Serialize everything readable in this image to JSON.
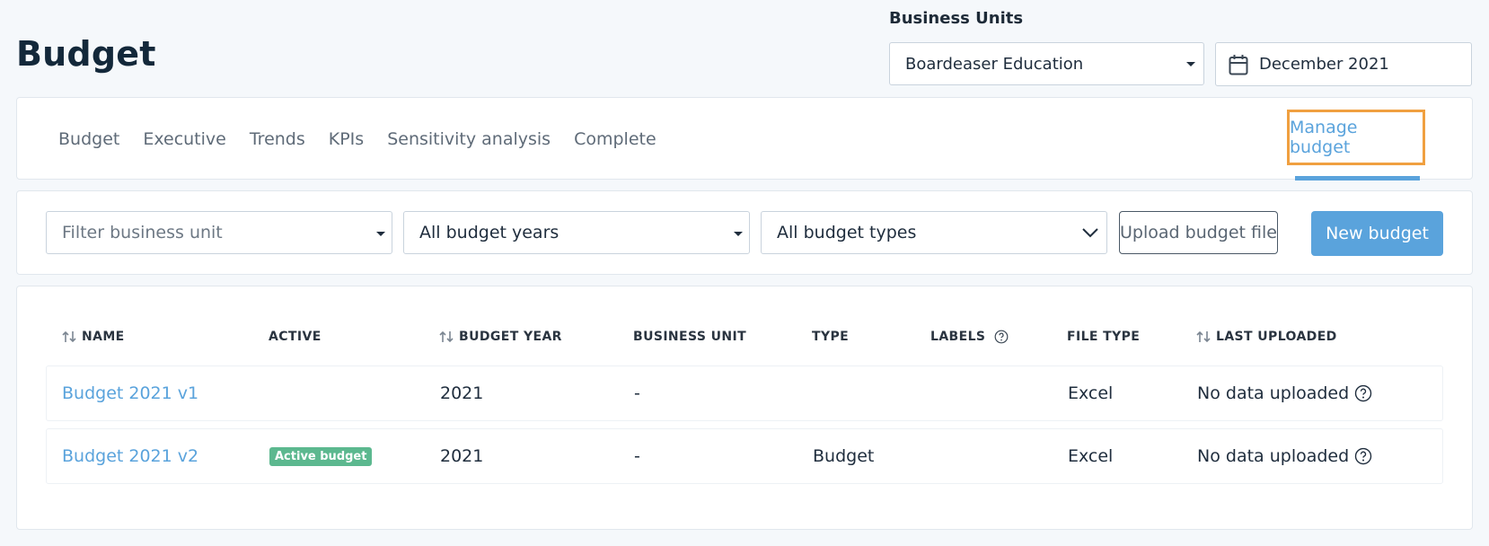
{
  "header": {
    "title": "Budget",
    "business_units_label": "Business Units",
    "business_unit_value": "Boardeaser Education",
    "date_value": "December 2021"
  },
  "nav": {
    "tabs": [
      "Budget",
      "Executive",
      "Trends",
      "KPIs",
      "Sensitivity analysis",
      "Complete"
    ],
    "manage_label": "Manage budget"
  },
  "filters": {
    "business_unit_placeholder": "Filter business unit",
    "years_value": "All budget years",
    "types_value": "All budget types",
    "upload_label": "Upload budget file",
    "new_label": "New budget"
  },
  "table": {
    "columns": {
      "name": "NAME",
      "active": "ACTIVE",
      "budget_year": "BUDGET YEAR",
      "business_unit": "BUSINESS UNIT",
      "type": "TYPE",
      "labels": "LABELS",
      "file_type": "FILE TYPE",
      "last_uploaded": "LAST UPLOADED"
    },
    "rows": [
      {
        "name": "Budget 2021 v1",
        "active": "",
        "budget_year": "2021",
        "business_unit": "-",
        "type": "",
        "file_type": "Excel",
        "last_uploaded": "No data uploaded"
      },
      {
        "name": "Budget 2021 v2",
        "active": "Active budget",
        "budget_year": "2021",
        "business_unit": "-",
        "type": "Budget",
        "file_type": "Excel",
        "last_uploaded": "No data uploaded"
      }
    ]
  },
  "colors": {
    "accent": "#5aa3dc",
    "highlight": "#f0a040",
    "active_badge": "#5cb88f"
  }
}
